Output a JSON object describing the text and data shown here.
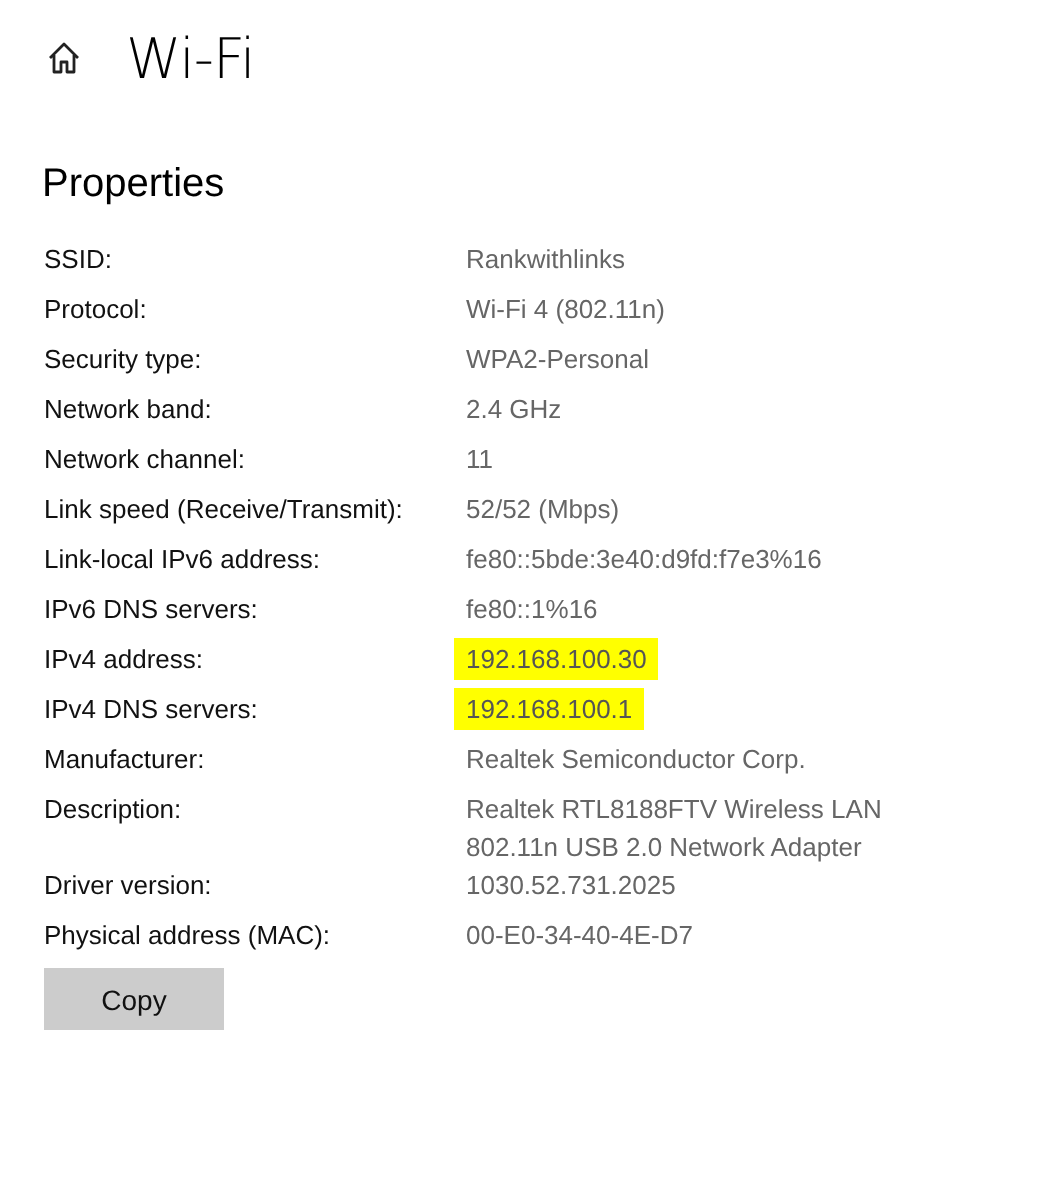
{
  "header": {
    "title": "Wi-Fi"
  },
  "section": {
    "title": "Properties"
  },
  "properties": [
    {
      "label": "SSID:",
      "value": "Rankwithlinks",
      "highlighted": false
    },
    {
      "label": "Protocol:",
      "value": "Wi-Fi 4 (802.11n)",
      "highlighted": false
    },
    {
      "label": "Security type:",
      "value": "WPA2-Personal",
      "highlighted": false
    },
    {
      "label": "Network band:",
      "value": "2.4 GHz",
      "highlighted": false
    },
    {
      "label": "Network channel:",
      "value": "11",
      "highlighted": false
    },
    {
      "label": "Link speed (Receive/Transmit):",
      "value": "52/52 (Mbps)",
      "highlighted": false
    },
    {
      "label": "Link-local IPv6 address:",
      "value": "fe80::5bde:3e40:d9fd:f7e3%16",
      "highlighted": false
    },
    {
      "label": "IPv6 DNS servers:",
      "value": "fe80::1%16",
      "highlighted": false
    },
    {
      "label": "IPv4 address:",
      "value": "192.168.100.30",
      "highlighted": true
    },
    {
      "label": "IPv4 DNS servers:",
      "value": "192.168.100.1",
      "highlighted": true
    },
    {
      "label": "Manufacturer:",
      "value": "Realtek Semiconductor Corp.",
      "highlighted": false
    },
    {
      "label": "Description:",
      "value": "Realtek RTL8188FTV Wireless LAN 802.11n USB 2.0 Network Adapter",
      "highlighted": false
    },
    {
      "label": "Driver version:",
      "value": "1030.52.731.2025",
      "highlighted": false
    },
    {
      "label": "Physical address (MAC):",
      "value": "00-E0-34-40-4E-D7",
      "highlighted": false
    }
  ],
  "copy_button": {
    "label": "Copy"
  }
}
